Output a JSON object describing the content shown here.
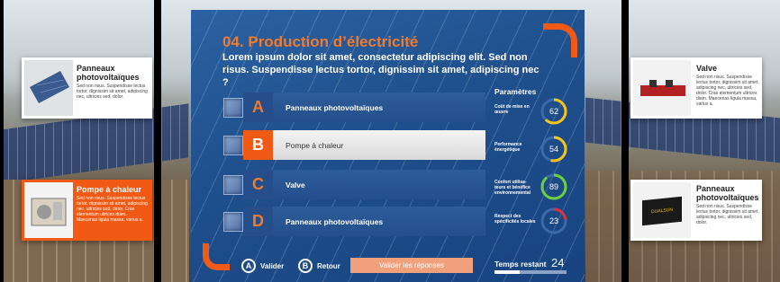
{
  "quiz": {
    "title": "04. Production d’électricité",
    "question": "Lorem ipsum dolor sit amet, consectetur adipiscing elit. Sed non risus. Suspendisse lectus tortor, dignissim sit amet, adipiscing nec ?",
    "answers": [
      {
        "letter": "A",
        "label": "Panneaux photovoltaïques",
        "selected": false
      },
      {
        "letter": "B",
        "label": "Pompe à chaleur",
        "selected": true
      },
      {
        "letter": "C",
        "label": "Valve",
        "selected": false
      },
      {
        "letter": "D",
        "label": "Panneaux photovoltaïques",
        "selected": false
      }
    ]
  },
  "params": {
    "title": "Paramètres",
    "items": [
      {
        "label": "Coût de mise en œuvre",
        "value": "62",
        "fraction": 0.62,
        "color": "#f5c518"
      },
      {
        "label": "Performance énergétique",
        "value": "54",
        "fraction": 0.54,
        "color": "#f5c518"
      },
      {
        "label": "Confort utilisa-teurs et bénéfice environnemental",
        "value": "89",
        "fraction": 0.89,
        "color": "#6fcf3a"
      },
      {
        "label": "Respect des spécificités locales",
        "value": "23",
        "fraction": 0.23,
        "color": "#e0303a"
      }
    ]
  },
  "footer": {
    "validate_key": "A",
    "validate_label": "Valider",
    "back_key": "B",
    "back_label": "Retour",
    "submit_label": "Valider les réponses",
    "time_label": "Temps restant",
    "time_value": "24",
    "time_fraction": 0.35
  },
  "cards": {
    "left_top": {
      "title": "Panneaux photovoltaïques",
      "text": "Sed non risus. Suspendisse lectus tortor, dignissim sit amet, adipiscing nec, ultricies sed, dolor."
    },
    "left_bottom": {
      "title": "Pompe à chaleur",
      "text": "Sed non risus. Suspendisse lectus tortor, dignissim sit amet, adipiscing nec, ultricies sed, dolor. Cras elementum ultrices diam. Maecenas ligula massa, varius a."
    },
    "right_top": {
      "title": "Valve",
      "text": "Sed non risus. Suspendisse lectus tortor, dignissim sit amet, adipiscing nec, ultricies sed, dolor. Cras elementum ultrices diam. Maecenas ligula massa, varius a."
    },
    "right_bottom": {
      "title": "Panneaux photovoltaïques",
      "text": "Sed non risus. Suspendisse lectus tortor, dignissim sit amet, adipiscing nec, ultricies sed, dolor.",
      "logo_text": "DUALSUN"
    }
  },
  "colors": {
    "accent": "#f05a14",
    "panel": "#1f4f8c"
  }
}
